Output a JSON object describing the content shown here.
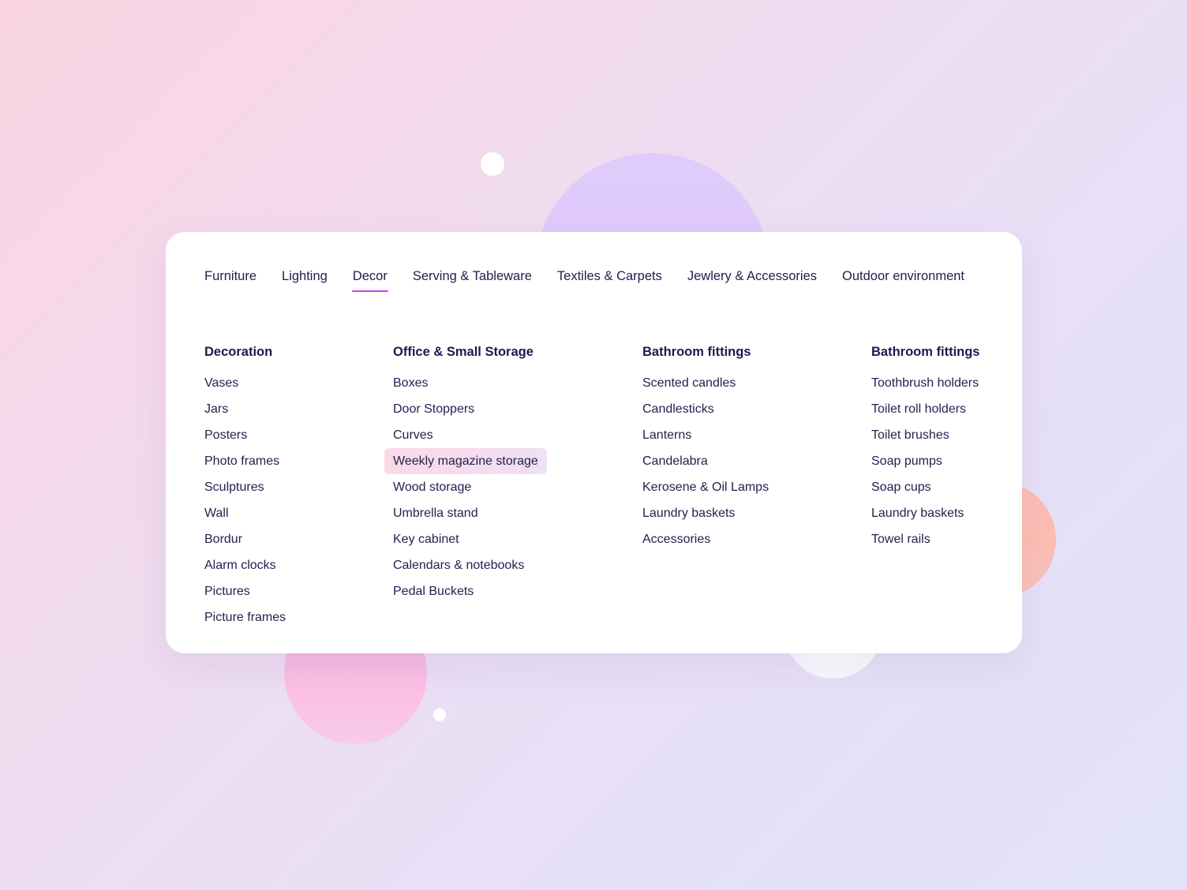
{
  "nav": {
    "tabs": [
      {
        "label": "Furniture",
        "active": false
      },
      {
        "label": "Lighting",
        "active": false
      },
      {
        "label": "Decor",
        "active": true
      },
      {
        "label": "Serving & Tableware",
        "active": false
      },
      {
        "label": "Textiles & Carpets",
        "active": false
      },
      {
        "label": "Jewlery & Accessories",
        "active": false
      },
      {
        "label": "Outdoor environment",
        "active": false
      }
    ]
  },
  "columns": [
    {
      "title": "Decoration",
      "items": [
        {
          "label": "Vases",
          "highlighted": false
        },
        {
          "label": "Jars",
          "highlighted": false
        },
        {
          "label": "Posters",
          "highlighted": false
        },
        {
          "label": "Photo frames",
          "highlighted": false
        },
        {
          "label": "Sculptures",
          "highlighted": false
        },
        {
          "label": "Wall",
          "highlighted": false
        },
        {
          "label": "Bordur",
          "highlighted": false
        },
        {
          "label": "Alarm clocks",
          "highlighted": false
        },
        {
          "label": "Pictures",
          "highlighted": false
        },
        {
          "label": "Picture frames",
          "highlighted": false
        }
      ]
    },
    {
      "title": "Office & Small Storage",
      "items": [
        {
          "label": "Boxes",
          "highlighted": false
        },
        {
          "label": "Door Stoppers",
          "highlighted": false
        },
        {
          "label": "Curves",
          "highlighted": false
        },
        {
          "label": "Weekly magazine storage",
          "highlighted": true
        },
        {
          "label": "Wood storage",
          "highlighted": false
        },
        {
          "label": "Umbrella stand",
          "highlighted": false
        },
        {
          "label": "Key cabinet",
          "highlighted": false
        },
        {
          "label": "Calendars & notebooks",
          "highlighted": false
        },
        {
          "label": "Pedal Buckets",
          "highlighted": false
        }
      ]
    },
    {
      "title": "Bathroom fittings",
      "items": [
        {
          "label": "Scented candles",
          "highlighted": false
        },
        {
          "label": "Candlesticks",
          "highlighted": false
        },
        {
          "label": "Lanterns",
          "highlighted": false
        },
        {
          "label": "Candelabra",
          "highlighted": false
        },
        {
          "label": "Kerosene & Oil Lamps",
          "highlighted": false
        },
        {
          "label": "Laundry baskets",
          "highlighted": false
        },
        {
          "label": "Accessories",
          "highlighted": false
        }
      ]
    },
    {
      "title": "Bathroom fittings",
      "items": [
        {
          "label": "Toothbrush holders",
          "highlighted": false
        },
        {
          "label": "Toilet roll holders",
          "highlighted": false
        },
        {
          "label": "Toilet brushes",
          "highlighted": false
        },
        {
          "label": "Soap pumps",
          "highlighted": false
        },
        {
          "label": "Soap cups",
          "highlighted": false
        },
        {
          "label": "Laundry baskets",
          "highlighted": false
        },
        {
          "label": "Towel rails",
          "highlighted": false
        }
      ]
    }
  ],
  "theme": {
    "accent": "#d63bf5",
    "text": "#23224f",
    "heading": "#1b1a4e",
    "card_background": "#ffffff",
    "background_start": "#fbd5e2",
    "background_end": "#e2e2f8",
    "highlight_start": "#fbdae8",
    "highlight_end": "#eee0f5"
  }
}
